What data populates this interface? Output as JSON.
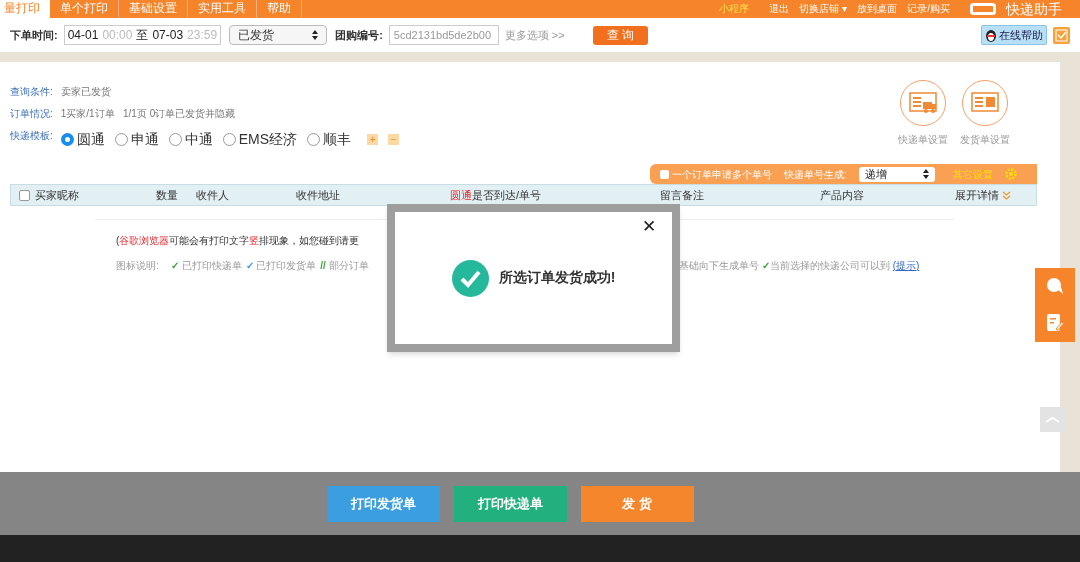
{
  "nav": {
    "tabs": [
      {
        "label": "量打印",
        "selected": true
      },
      {
        "label": "单个打印",
        "selected": false
      },
      {
        "label": "基础设置",
        "selected": false
      },
      {
        "label": "实用工具",
        "selected": false
      },
      {
        "label": "帮助",
        "selected": false
      }
    ],
    "links": [
      {
        "label": "小程序",
        "kind": "highlight"
      },
      {
        "label": "退出",
        "kind": "plain"
      },
      {
        "label": "切换店铺 ▾",
        "kind": "plain"
      },
      {
        "label": "放到桌面",
        "kind": "plain"
      },
      {
        "label": "记录/购买",
        "kind": "plain"
      }
    ],
    "brand": "快递助手"
  },
  "filter": {
    "time_label": "下单时间:",
    "from_date": "04-01",
    "from_time": "00:00",
    "to_word": "至",
    "to_date": "07-03",
    "to_time": "23:59",
    "status": "已发货",
    "group_label": "团购编号:",
    "group_value": "5cd2131bd5de2b00",
    "more": "更多选项 >>",
    "query": "查 询",
    "help": "在线帮助"
  },
  "info": [
    {
      "label": "查询条件:",
      "value": "卖家已发货"
    },
    {
      "label": "订单情况:",
      "value": "1买家/1订单   1/1页 0订单已发货并隐藏"
    }
  ],
  "templates": {
    "label": "快递模板:",
    "items": [
      {
        "label": "圆通",
        "selected": true
      },
      {
        "label": "申通",
        "selected": false
      },
      {
        "label": "中通",
        "selected": false
      },
      {
        "label": "EMS经济",
        "selected": false
      },
      {
        "label": "顺丰",
        "selected": false
      }
    ],
    "add": "+",
    "remove": "−"
  },
  "settings": [
    {
      "label": "快递单设置",
      "kind": "truck"
    },
    {
      "label": "发货单设置",
      "kind": "sheet"
    }
  ],
  "options_bar": {
    "multi_label": "一个订单申请多个单号",
    "multi_checked": false,
    "gen_label": "快递单号生成:",
    "gen_value": "递增",
    "other": "其它设置"
  },
  "table": {
    "select_all_checked": false,
    "columns": [
      "买家昵称",
      "数量",
      "收件人",
      "收件地址",
      "圆通",
      "是否到达/单号",
      "留言备注",
      "产品内容",
      "展开详情"
    ]
  },
  "notice": {
    "parts": [
      {
        "text": "(",
        "kind": "plain"
      },
      {
        "text": "谷歌浏览器",
        "kind": "red"
      },
      {
        "text": "可能会有打印文字",
        "kind": "plain"
      },
      {
        "text": "竖",
        "kind": "red"
      },
      {
        "text": "排现象，如您碰到请更",
        "kind": "plain"
      }
    ]
  },
  "legend": {
    "label": "图标说明:",
    "left": [
      {
        "mark": "✓",
        "text": "已打印快递单",
        "kind": "green"
      },
      {
        "mark": "✓",
        "text": "已打印发货单",
        "kind": "blue"
      },
      {
        "mark": "//",
        "text": "部分订单",
        "kind": "green"
      }
    ],
    "right": [
      {
        "text": "基础向下生成单号"
      },
      {
        "mark": "✓",
        "text": "当前选择的快递公司可以到",
        "kind": "green"
      }
    ],
    "link": "(提示)"
  },
  "modal": {
    "message": "所选订单发货成功!",
    "close": "✕"
  },
  "actions": [
    {
      "label": "打印发货单",
      "kind": "blue"
    },
    {
      "label": "打印快递单",
      "kind": "green"
    },
    {
      "label": "发 货",
      "kind": "orange"
    }
  ]
}
